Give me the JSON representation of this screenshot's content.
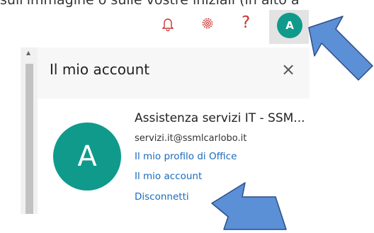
{
  "caption": "sull'immagine o sulle vostre iniziali (in alto a",
  "topbar": {
    "icons": [
      "bell-icon",
      "gear-icon",
      "help-icon"
    ],
    "help_glyph": "?",
    "avatar_initial": "A"
  },
  "account_panel": {
    "title": "Il mio account",
    "close_glyph": "×",
    "avatar_initial": "A",
    "account_name": "Assistenza servizi IT - SSM...",
    "email": "servizi.it@ssmlcarlobo.it",
    "links": {
      "office_profile": "Il mio profilo di Office",
      "my_account": "Il mio account",
      "sign_out": "Disconnetti"
    }
  },
  "colors": {
    "avatar": "#0f9a8c",
    "link": "#1a6bbd",
    "topbar_icons": "#cc3333",
    "arrows": "#5b8fd6"
  }
}
